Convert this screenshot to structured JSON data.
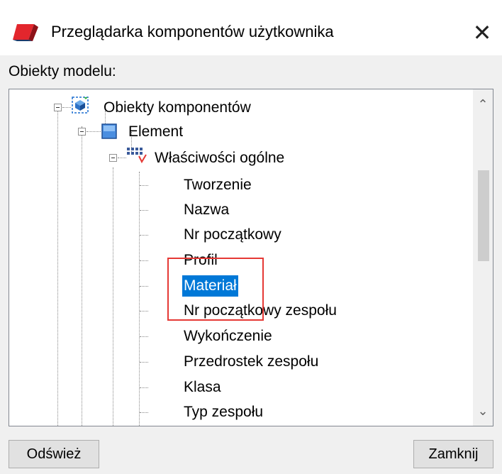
{
  "window": {
    "title": "Przeglądarka komponentów użytkownika",
    "close_glyph": "✕",
    "icon": "app-icon"
  },
  "section_label": "Obiekty modelu:",
  "tree": {
    "root": {
      "label": "Obiekty komponentów",
      "icon": "components-icon"
    },
    "element": {
      "label": "Element",
      "icon": "element-icon"
    },
    "general": {
      "label": "Właściwości ogólne",
      "icon": "properties-icon"
    },
    "items": [
      {
        "label": "Tworzenie"
      },
      {
        "label": "Nazwa"
      },
      {
        "label": "Nr początkowy"
      },
      {
        "label": "Profil"
      },
      {
        "label": "Materiał",
        "selected": true
      },
      {
        "label": "Nr początkowy zespołu"
      },
      {
        "label": "Wykończenie"
      },
      {
        "label": "Przedrostek zespołu"
      },
      {
        "label": "Klasa"
      },
      {
        "label": "Typ zespołu"
      }
    ]
  },
  "scrollbar": {
    "up_glyph": "⌃",
    "down_glyph": "⌄"
  },
  "buttons": {
    "refresh": "Odśwież",
    "close": "Zamknij"
  },
  "colors": {
    "selection": "#0078d7",
    "highlight": "#e53935"
  }
}
